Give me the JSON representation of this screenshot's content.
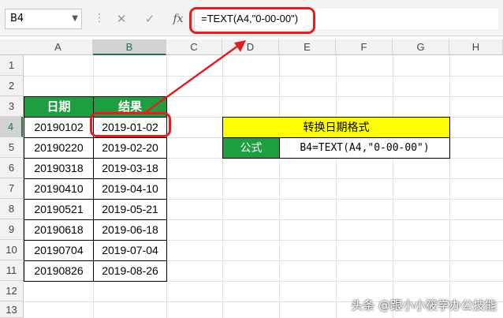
{
  "formula_bar": {
    "name_box": "B4",
    "cancel_icon": "✕",
    "enter_icon": "✓",
    "fx_label": "fx",
    "formula": "=TEXT(A4,\"0-00-00\")"
  },
  "columns": [
    "A",
    "B",
    "C",
    "D",
    "E",
    "F",
    "G",
    "H"
  ],
  "rows": [
    "1",
    "2",
    "3",
    "4",
    "5",
    "6",
    "7",
    "8",
    "9",
    "10",
    "11",
    "12",
    "13"
  ],
  "table": {
    "headers": [
      "日期",
      "结果"
    ],
    "rows": [
      [
        "20190102",
        "2019-01-02"
      ],
      [
        "20190220",
        "2019-02-20"
      ],
      [
        "20190318",
        "2019-03-18"
      ],
      [
        "20190410",
        "2019-04-10"
      ],
      [
        "20190521",
        "2019-05-21"
      ],
      [
        "20190618",
        "2019-06-18"
      ],
      [
        "20190704",
        "2019-07-04"
      ],
      [
        "20190826",
        "2019-08-26"
      ]
    ]
  },
  "info_box": {
    "title": "转换日期格式",
    "label": "公式",
    "value": "B4=TEXT(A4,\"0-00-00\")"
  },
  "colors": {
    "header_green": "#1e9e41",
    "title_yellow": "#ffff00",
    "highlight_red": "#e02020"
  },
  "watermark": "头条 @跟小小筱学办公技能"
}
